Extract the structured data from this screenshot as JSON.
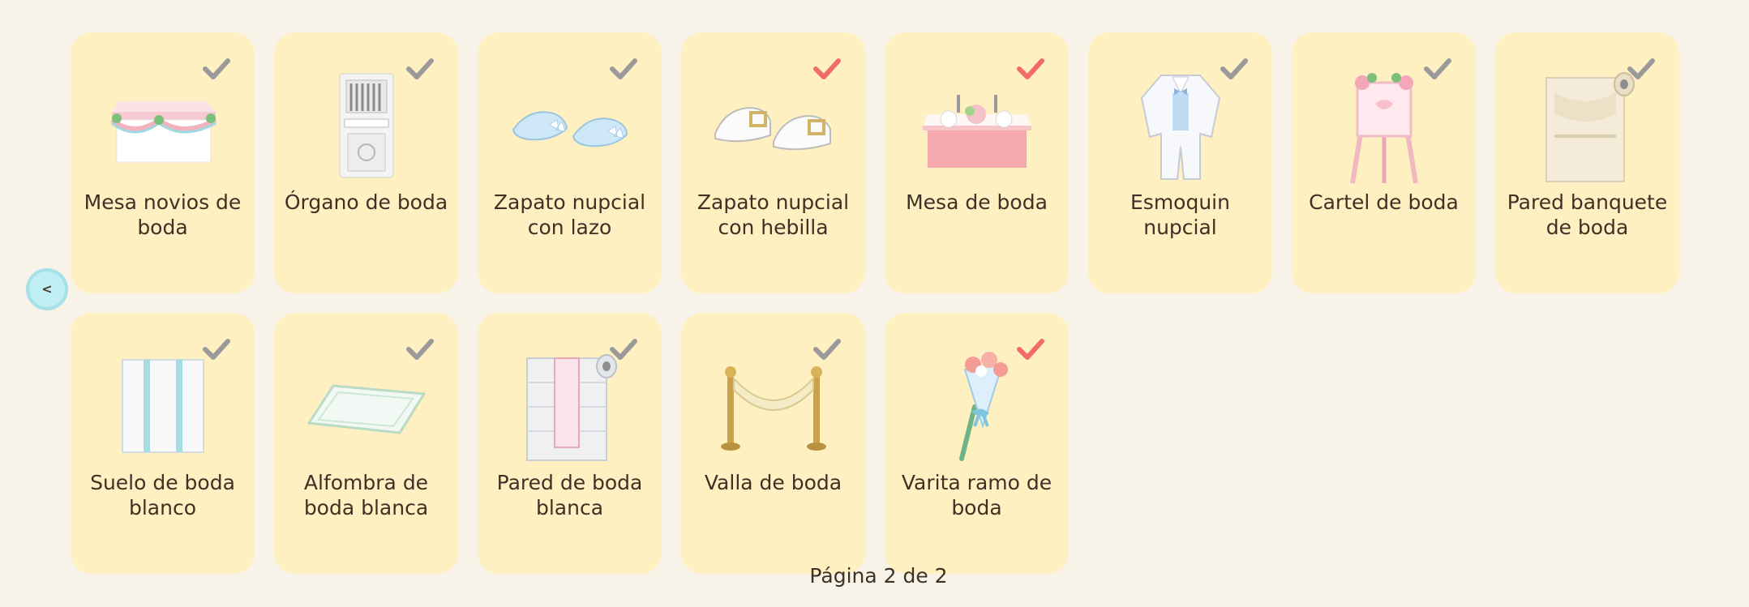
{
  "colors": {
    "background": "#f8f3e8",
    "card": "#fff0c2",
    "check_collected": "#9a9a9a",
    "check_highlight": "#f16b6b",
    "nav_button": "#bfeff2"
  },
  "nav": {
    "prev_label": "<"
  },
  "items": [
    {
      "name": "Mesa novios de boda",
      "check": "grey",
      "icon": "bridal-table-icon"
    },
    {
      "name": "Órgano de boda",
      "check": "grey",
      "icon": "organ-icon"
    },
    {
      "name": "Zapato nupcial con lazo",
      "check": "grey",
      "icon": "ribbon-shoes-icon"
    },
    {
      "name": "Zapato nupcial con hebilla",
      "check": "red",
      "icon": "buckle-shoes-icon"
    },
    {
      "name": "Mesa de boda",
      "check": "red",
      "icon": "wedding-table-icon"
    },
    {
      "name": "Esmoquin nupcial",
      "check": "grey",
      "icon": "tuxedo-icon"
    },
    {
      "name": "Cartel de boda",
      "check": "grey",
      "icon": "easel-sign-icon"
    },
    {
      "name": "Pared banquete de boda",
      "check": "grey",
      "icon": "wallpaper-roll-icon"
    },
    {
      "name": "Suelo de boda blanco",
      "check": "grey",
      "icon": "floor-tile-icon"
    },
    {
      "name": "Alfombra de boda blanca",
      "check": "grey",
      "icon": "rug-icon"
    },
    {
      "name": "Pared de boda blanca",
      "check": "grey",
      "icon": "white-wall-roll-icon"
    },
    {
      "name": "Valla de boda",
      "check": "grey",
      "icon": "rope-barrier-icon"
    },
    {
      "name": "Varita ramo de boda",
      "check": "red",
      "icon": "bouquet-wand-icon"
    }
  ],
  "pagination": {
    "label": "Página 2 de 2"
  }
}
